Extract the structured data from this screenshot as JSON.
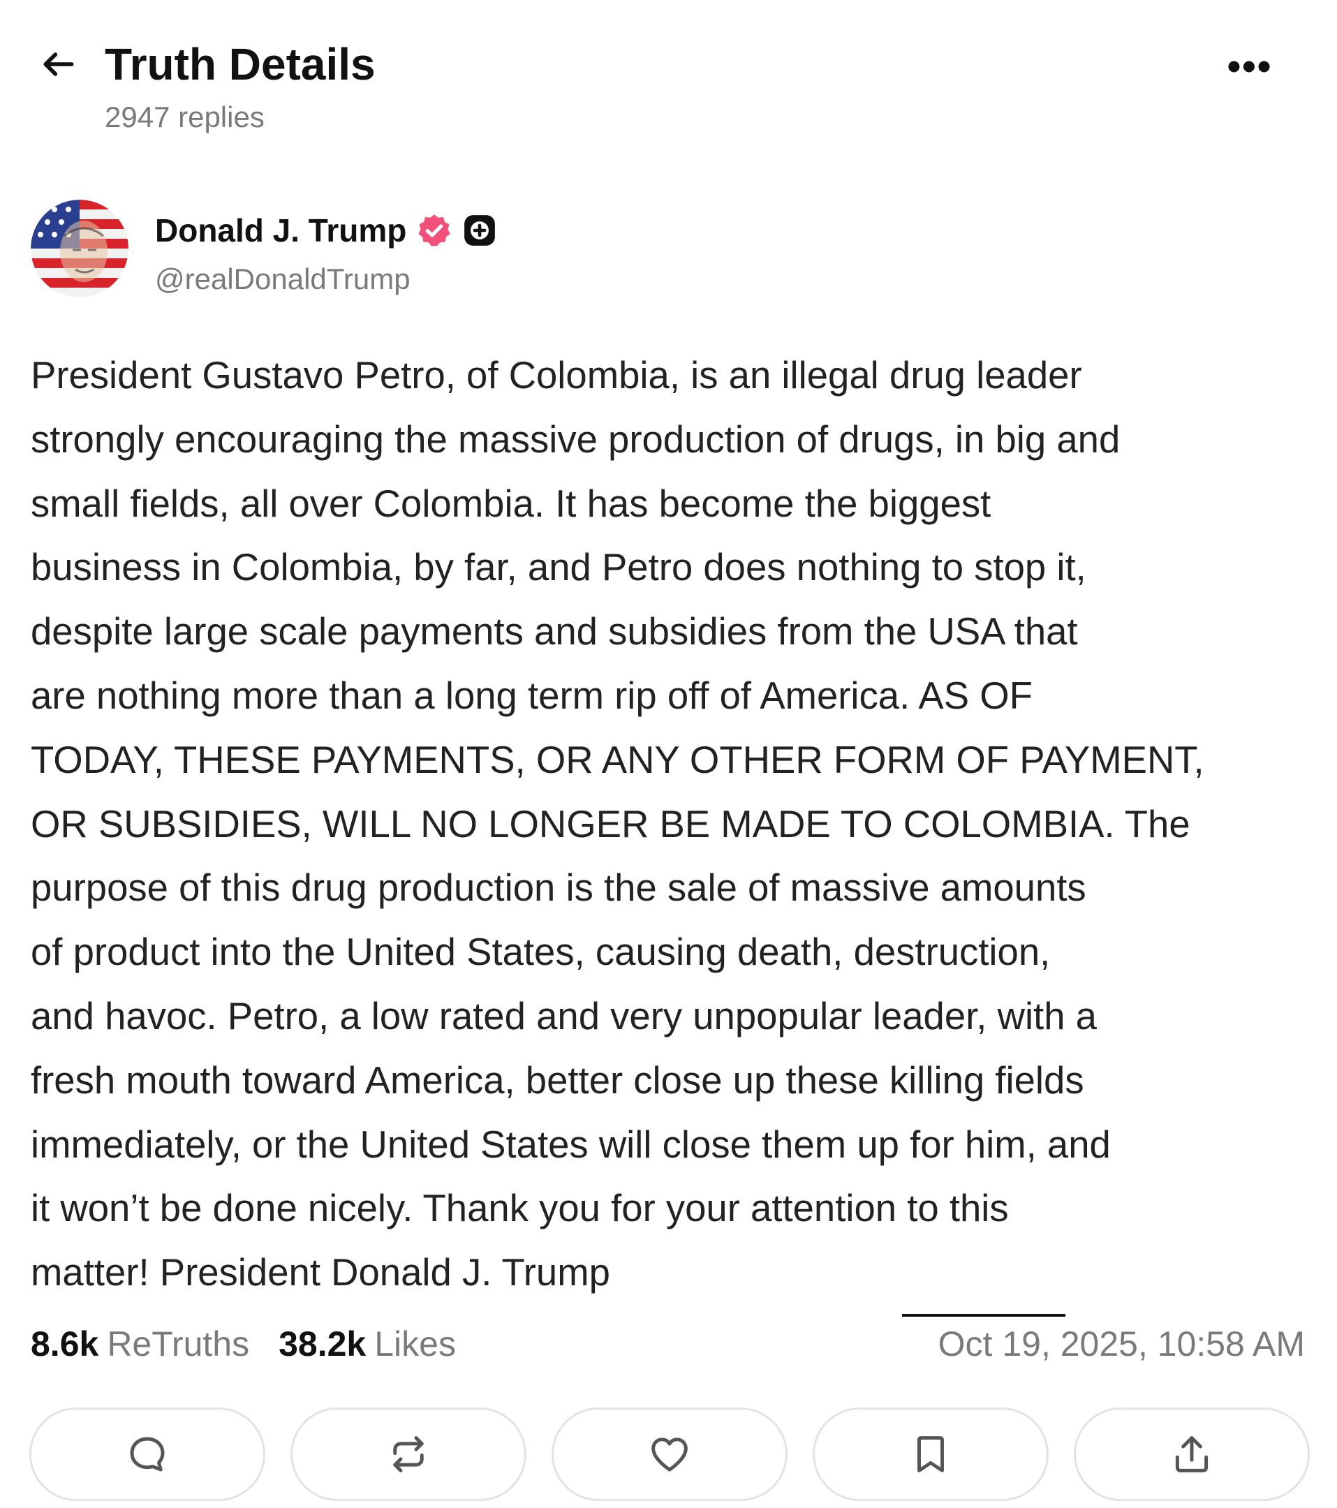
{
  "header": {
    "title": "Truth Details",
    "replies": "2947 replies",
    "more_label": "•••"
  },
  "author": {
    "name": "Donald J. Trump",
    "handle": "@realDonaldTrump"
  },
  "post": {
    "text": "President Gustavo Petro, of Colombia, is an illegal drug leader\nstrongly encouraging the massive production of drugs, in big and\nsmall fields, all over Colombia. It has become the biggest\nbusiness in Colombia, by far, and Petro does nothing to stop it,\ndespite large scale payments and subsidies from the USA that\nare nothing more than a long term rip off of America. AS OF\nTODAY, THESE PAYMENTS, OR ANY OTHER FORM OF PAYMENT,\nOR SUBSIDIES, WILL NO LONGER BE MADE TO COLOMBIA. The\npurpose of this drug production is the sale of massive amounts\nof product into the United States, causing death, destruction,\nand havoc. Petro, a low rated and very unpopular leader, with a\nfresh mouth toward America, better close up these killing fields\nimmediately, or the United States will close them up for him, and\nit won’t be done nicely. Thank you for your attention to this\nmatter! President Donald J. Trump"
  },
  "stats": {
    "retruths_count": "8.6k",
    "retruths_label": "ReTruths",
    "likes_count": "38.2k",
    "likes_label": "Likes",
    "timestamp": "Oct 19, 2025, 10:58 AM"
  },
  "colors": {
    "verified_badge": "#f0507a",
    "text_primary": "#111111",
    "text_secondary": "#7a7a7a",
    "button_border": "#e3e3e3"
  },
  "actions": {
    "icons": [
      "reply-icon",
      "retruth-icon",
      "like-icon",
      "bookmark-icon",
      "share-icon"
    ]
  }
}
